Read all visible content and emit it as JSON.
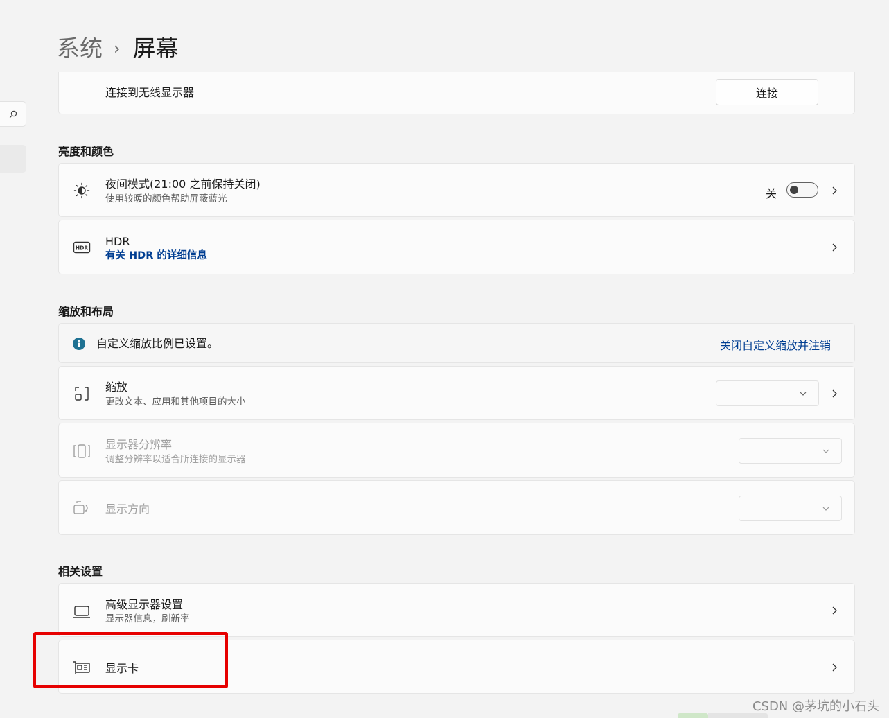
{
  "breadcrumb": {
    "parent": "系统",
    "separator": "›",
    "current": "屏幕"
  },
  "wireless": {
    "label": "连接到无线显示器",
    "button": "连接"
  },
  "sections": {
    "brightness": "亮度和颜色",
    "scale_layout": "缩放和布局",
    "related": "相关设置"
  },
  "night_light": {
    "title": "夜间模式(21:00 之前保持关闭)",
    "subtitle": "使用较暖的颜色帮助屏蔽蓝光",
    "state": "关"
  },
  "hdr": {
    "title": "HDR",
    "link": "有关 HDR 的详细信息"
  },
  "scale_info": {
    "message": "自定义缩放比例已设置。",
    "action": "关闭自定义缩放并注销"
  },
  "scale": {
    "title": "缩放",
    "subtitle": "更改文本、应用和其他项目的大小"
  },
  "resolution": {
    "title": "显示器分辨率",
    "subtitle": "调整分辨率以适合所连接的显示器"
  },
  "orientation": {
    "title": "显示方向"
  },
  "advanced_display": {
    "title": "高级显示器设置",
    "subtitle": "显示器信息，刷新率"
  },
  "graphics": {
    "title": "显示卡"
  },
  "watermark": "CSDN @茅坑的小石头",
  "icons": [
    "search-icon",
    "brightness-icon",
    "hdr-icon",
    "info-icon",
    "scale-icon",
    "resolution-icon",
    "orientation-icon",
    "monitor-icon",
    "graphics-card-icon",
    "chevron-right-icon",
    "chevron-down-icon"
  ],
  "colors": {
    "accent": "#003e92",
    "info": "#1e7192",
    "highlight": "#e60000"
  }
}
